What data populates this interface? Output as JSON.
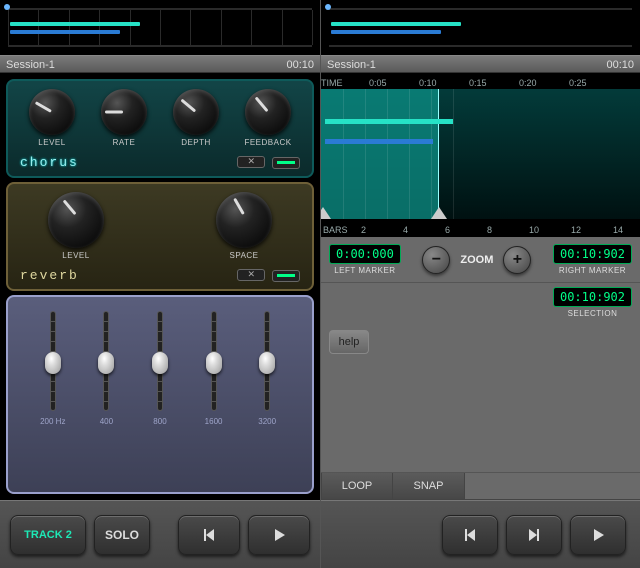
{
  "left": {
    "session_name": "Session-1",
    "session_time": "00:10",
    "rack_chorus": {
      "title": "chorus",
      "knobs": [
        "LEVEL",
        "RATE",
        "DEPTH",
        "FEEDBACK"
      ],
      "knob_angles": [
        -60,
        -90,
        -50,
        -40
      ]
    },
    "rack_reverb": {
      "title": "reverb",
      "knobs": [
        "LEVEL",
        "SPACE"
      ],
      "knob_angles": [
        -40,
        -30
      ]
    },
    "eq_bands": [
      "200 Hz",
      "400",
      "800",
      "1600",
      "3200"
    ],
    "eq_positions": [
      50,
      50,
      50,
      50,
      50
    ],
    "track_button": "TRACK 2",
    "solo_button": "SOLO"
  },
  "right": {
    "session_name": "Session-1",
    "session_time": "00:10",
    "time_label": "TIME",
    "time_ticks": [
      "0:05",
      "0:10",
      "0:15",
      "0:20",
      "0:25"
    ],
    "bars_label": "BARS",
    "bars_ticks": [
      "2",
      "4",
      "6",
      "8",
      "10",
      "12",
      "14"
    ],
    "left_marker_value": "0:00:000",
    "left_marker_label": "LEFT MARKER",
    "zoom_label": "ZOOM",
    "right_marker_value": "00:10:902",
    "right_marker_label": "RIGHT MARKER",
    "selection_value": "00:10:902",
    "selection_label": "SELECTION",
    "help": "help",
    "tabs": [
      "LOOP",
      "SNAP"
    ]
  }
}
